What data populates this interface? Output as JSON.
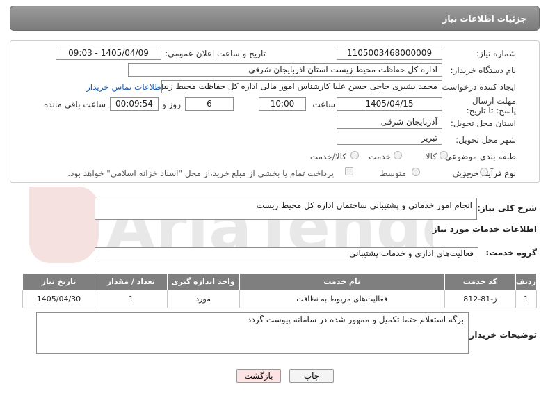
{
  "header": {
    "title": "جزئیات اطلاعات نیاز"
  },
  "form": {
    "need_number_label": "شماره نیاز:",
    "need_number": "1105003468000009",
    "announce_label": "تاریخ و ساعت اعلان عمومی:",
    "announce_value": "1405/04/09 - 09:03",
    "buyer_org_label": "نام دستگاه خریدار:",
    "buyer_org": "اداره کل حفاظت محیط زیست استان اذربایجان شرقی",
    "creator_label": "ایجاد کننده درخواست:",
    "creator": "محمد بشیری حاجی حسن علیا کارشناس امور مالی اداره کل حفاظت محیط زیست استان",
    "contact_link": "اطلاعات تماس خریدار",
    "deadline_label": "مهلت ارسال پاسخ: تا تاریخ:",
    "deadline_date": "1405/04/15",
    "time_label": "ساعت",
    "deadline_time": "10:00",
    "days_value": "6",
    "days_label": "روز و",
    "remaining_time": "00:09:54",
    "remaining_label": "ساعت باقی مانده",
    "province_label": "استان محل تحویل:",
    "province": "آذربایجان شرقی",
    "city_label": "شهر محل تحویل:",
    "city": "تبریز",
    "category_label": "طبقه بندی موضوعی:",
    "category_options": [
      "کالا",
      "خدمت",
      "کالا/خدمت"
    ],
    "process_label": "نوع فرآیند خرید :",
    "process_options": [
      "جزیی",
      "متوسط"
    ],
    "payment_note": "پرداخت تمام یا بخشی از مبلغ خرید،از محل \"اسناد خزانه اسلامی\" خواهد بود."
  },
  "summary": {
    "label": "شرح کلی نیاز:",
    "value": "انجام امور خدماتی و پشتیبانی ساختمان اداره کل محیط زیست"
  },
  "services": {
    "section_title": "اطلاعات خدمات مورد نیاز",
    "group_label": "گروه خدمت:",
    "group_value": "فعالیت‌های اداری و خدمات پشتیبانی"
  },
  "table": {
    "headers": [
      "ردیف",
      "کد خدمت",
      "نام خدمت",
      "واحد اندازه گیری",
      "تعداد / مقدار",
      "تاریخ نیاز"
    ],
    "rows": [
      [
        "1",
        "ز-81-812",
        "فعالیت‌های مربوط به نظافت",
        "مورد",
        "1",
        "1405/04/30"
      ]
    ]
  },
  "buyer_notes": {
    "label": "توضیحات خریدار:",
    "value": "برگه استعلام حتما تکمیل و ممهور شده در سامانه پیوست گردد"
  },
  "buttons": {
    "print": "چاپ",
    "back": "بازگشت"
  },
  "watermark": {
    "text": "AriaTender.neT"
  },
  "colors": {
    "header_bg": "#8a8a8a",
    "table_header_bg": "#7f7f7f",
    "link": "#1a5fb4",
    "back_button_bg": "#fde4e4"
  }
}
